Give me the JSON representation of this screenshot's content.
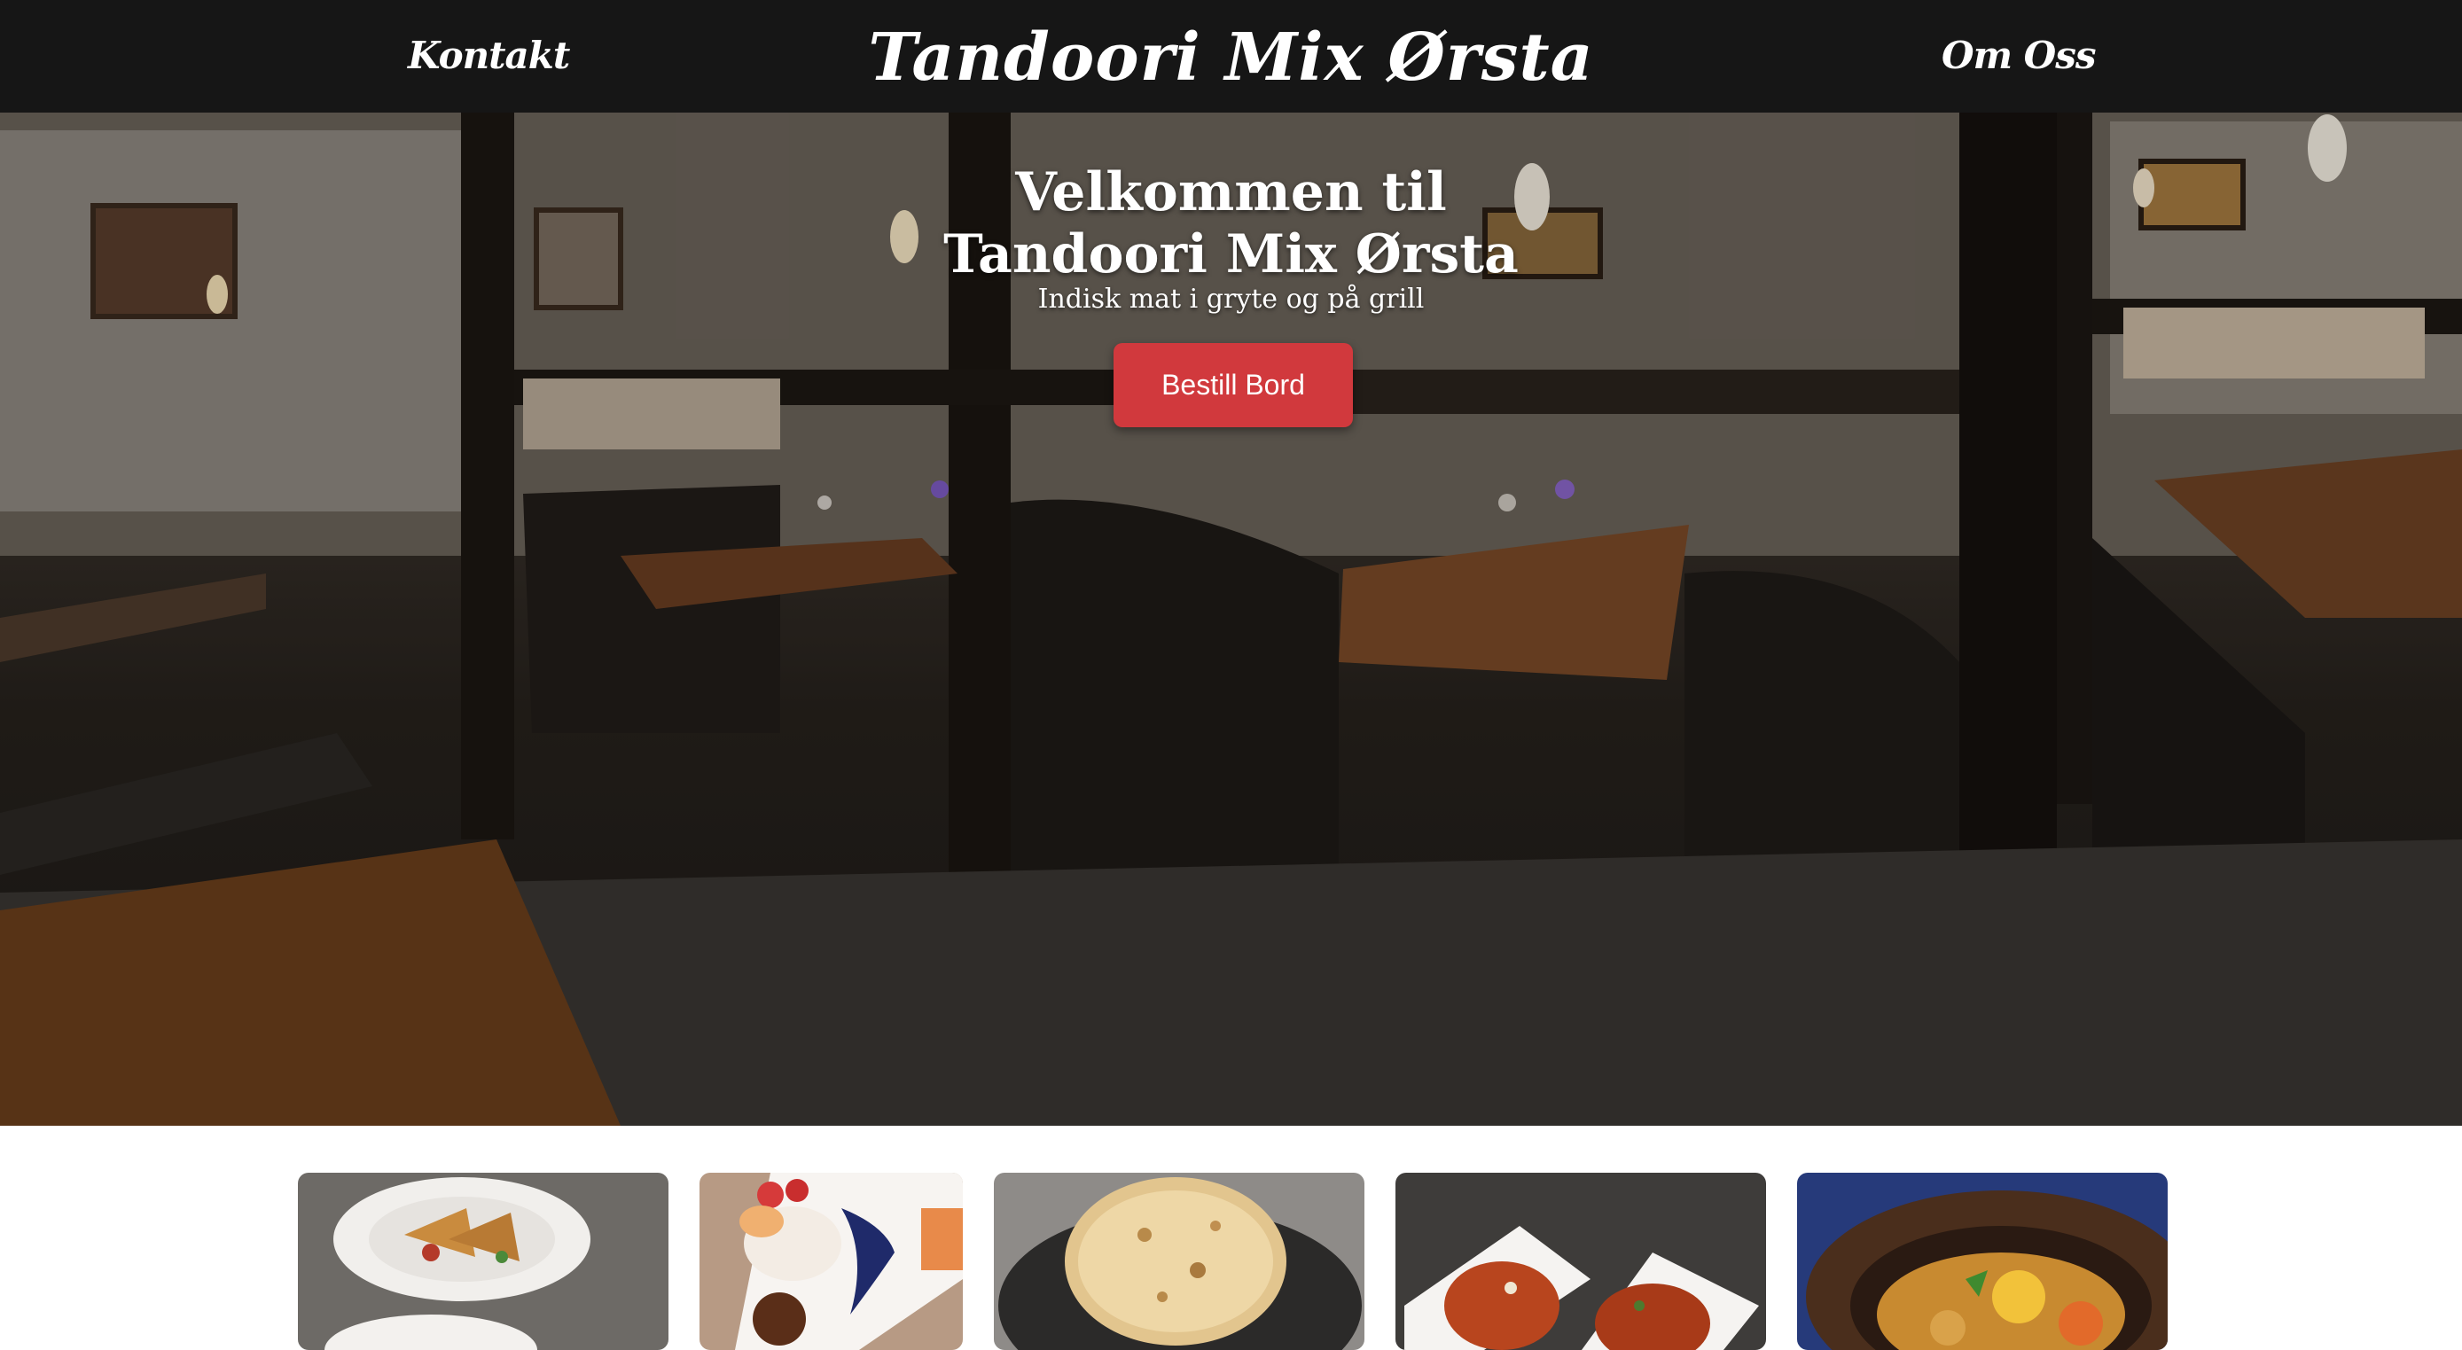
{
  "nav": {
    "left_link": "Kontakt",
    "brand": "Tandoori Mix Ørsta",
    "right_link": "Om Oss"
  },
  "hero": {
    "title_line1": "Velkommen til",
    "title_line2": "Tandoori Mix Ørsta",
    "subtitle": "Indisk mat i gryte og på grill",
    "cta_label": "Bestill Bord",
    "cta_color": "#d1393d",
    "background_image": "restaurant-interior-photo"
  },
  "gallery": {
    "photos": [
      {
        "subject": "samosa-plate-photo"
      },
      {
        "subject": "dessert-plate-photo"
      },
      {
        "subject": "naan-bread-photo"
      },
      {
        "subject": "curry-bowls-photo"
      },
      {
        "subject": "sizzling-dish-photo"
      }
    ]
  },
  "colors": {
    "navbar_bg": "#161616",
    "nav_text": "#ffffff",
    "button_bg": "#d1393d"
  }
}
